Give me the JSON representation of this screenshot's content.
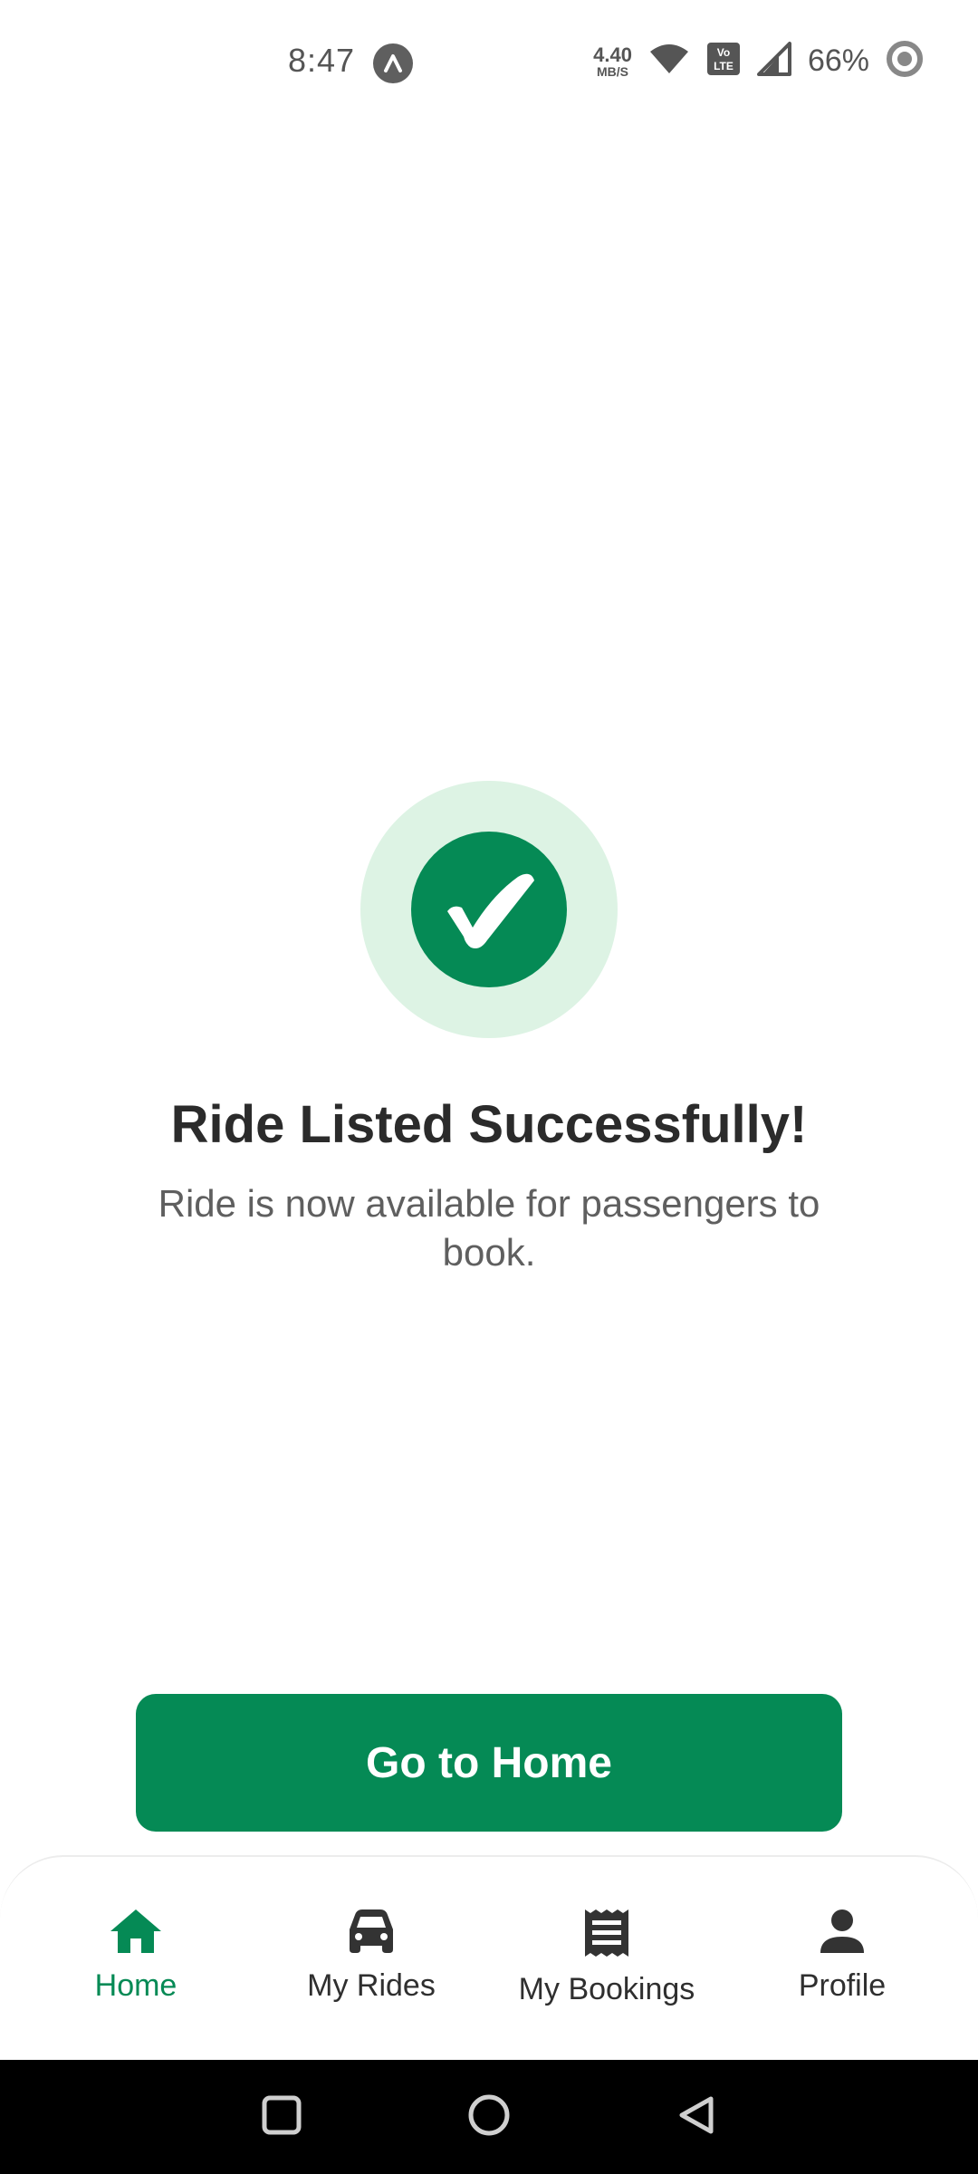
{
  "status_bar": {
    "time": "8:47",
    "net_speed_value": "4.40",
    "net_speed_unit": "MB/S",
    "volte_label": "Vo LTE",
    "battery": "66%"
  },
  "success": {
    "title": "Ride Listed Successfully!",
    "subtitle": "Ride is now available for passengers to book.",
    "icon": "check-circle-icon",
    "colors": {
      "accent": "#058a55",
      "halo": "#ddf3e4"
    }
  },
  "primary_action": {
    "label": "Go to Home"
  },
  "bottom_nav": {
    "active": "Home",
    "items": [
      {
        "label": "Home",
        "icon": "home-icon"
      },
      {
        "label": "My Rides",
        "icon": "car-icon"
      },
      {
        "label": "My Bookings",
        "icon": "receipt-icon"
      },
      {
        "label": "Profile",
        "icon": "person-icon"
      }
    ]
  },
  "system_nav": {
    "buttons": [
      "recents-icon",
      "home-circle-icon",
      "back-icon"
    ]
  }
}
